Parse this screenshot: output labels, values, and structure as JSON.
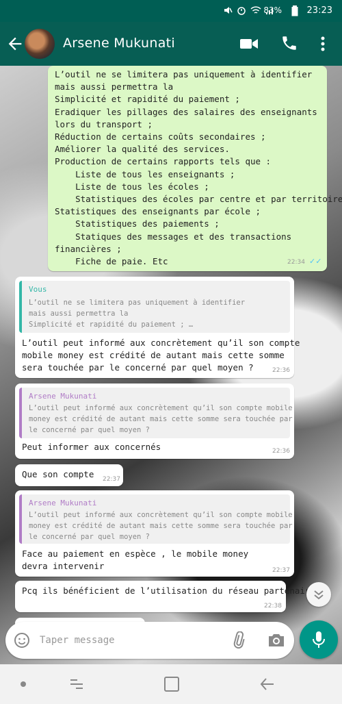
{
  "status_bar": {
    "icons": [
      "mute-icon",
      "alarm-icon",
      "wifi-icon",
      "signal-icon",
      "battery-icon"
    ],
    "battery": "83%",
    "time": "23:23"
  },
  "header": {
    "contact_name": "Arsene Mukunati",
    "icons": [
      "back-arrow-icon",
      "video-call-icon",
      "phone-icon",
      "more-vert-icon"
    ]
  },
  "messages": {
    "m1": {
      "lines": [
        "L’outil ne se limitera pas uniquement à identifier",
        "mais aussi permettra la",
        "Simplicité et rapidité du paiement ;",
        "Eradiquer les pillages des salaires des enseignants",
        "lors du transport ;",
        "Réduction de certains coûts secondaires ;",
        "Améliorer la qualité des services.",
        "Production de certains rapports tels que :",
        "    Liste de tous les enseignants ;",
        "    Liste de tous les écoles ;",
        "    Statistiques des écoles par centre et par territoire ;",
        "Statistiques des enseignants par école ;",
        "    Statistiques des paiements ;",
        "    Statiques des messages et des transactions",
        "financières ;",
        "    Fiche de paie. Etc"
      ],
      "time": "22:34"
    },
    "m2": {
      "quote_author": "Vous",
      "quote_lines": [
        "L’outil ne se limitera pas uniquement à identifier",
        "mais aussi permettra la",
        "Simplicité et rapidité du paiement ; …"
      ],
      "lines": [
        "L’outil peut informé aux concrètement qu’il son compte",
        "mobile money est crédité de autant mais cette somme",
        "sera touchée par le concerné par quel moyen ?"
      ],
      "time": "22:36"
    },
    "m3": {
      "quote_author": "Arsene Mukunati",
      "quote_lines": [
        "L’outil peut informé aux concrètement qu’il son compte mobile",
        "money est crédité de autant mais cette somme sera touchée par",
        "le concerné par quel moyen ?"
      ],
      "lines": [
        "Peut informer aux concernés"
      ],
      "time": "22:36"
    },
    "m4": {
      "lines": [
        "Que son compte"
      ],
      "time": "22:37"
    },
    "m5": {
      "quote_author": "Arsene Mukunati",
      "quote_lines": [
        "L’outil peut informé aux concrètement qu’il son compte mobile",
        "money est crédité de autant mais cette somme sera touchée par",
        "le concerné par quel moyen ?"
      ],
      "lines": [
        "Face au paiement en espèce , le mobile money",
        "devra intervenir"
      ],
      "time": "22:37"
    },
    "m6": {
      "lines": [
        "Pcq ils bénéficient de l’utilisation du réseau partenaire"
      ],
      "time": "22:38"
    }
  },
  "composer": {
    "placeholder": "Taper message",
    "icons": [
      "emoji-icon",
      "attach-icon",
      "camera-icon",
      "mic-icon"
    ]
  },
  "colors": {
    "header": "#075e54",
    "status_bar": "#005e54",
    "outgoing_bubble": "#dcf8c6",
    "incoming_bubble": "#ffffff",
    "quote_self": "#34b7a7",
    "quote_contact": "#b07cc6",
    "mic_button": "#009688",
    "read_ticks": "#4fc3f7"
  }
}
